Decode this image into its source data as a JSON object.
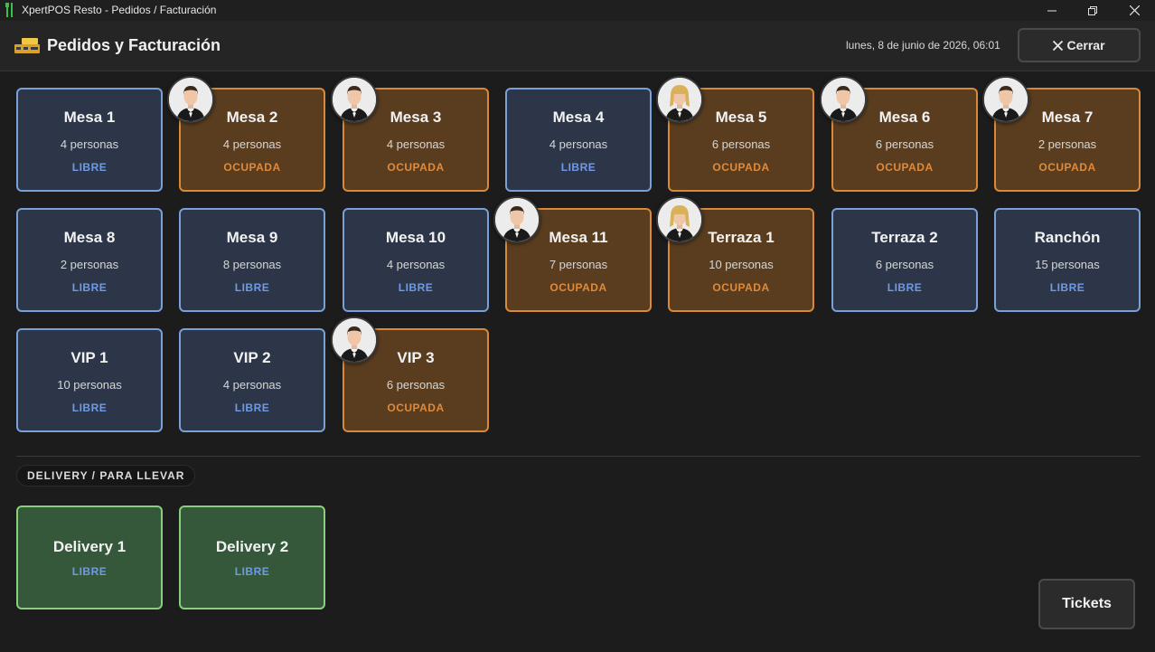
{
  "window": {
    "title": "XpertPOS Resto - Pedidos / Facturación",
    "controls": [
      "minimize-icon",
      "restore-icon",
      "close-icon"
    ]
  },
  "header": {
    "title": "Pedidos y Facturación",
    "icon": "cash-register-icon",
    "datetime": "lunes, 8 de junio de 2026, 06:01",
    "close_label": "Cerrar"
  },
  "colors": {
    "free_bg": "#2c3648",
    "free_border": "#7aa0d8",
    "free_text": "#6f9be6",
    "occupied_bg": "#5a3d1f",
    "occupied_border": "#d8893a",
    "occupied_text": "#e08a3a",
    "delivery_bg": "#35573a",
    "delivery_border": "#88d07c"
  },
  "tables": [
    {
      "name": "Mesa 1",
      "capacity": "4 personas",
      "status": "LIBRE",
      "waiter": null
    },
    {
      "name": "Mesa 2",
      "capacity": "4 personas",
      "status": "OCUPADA",
      "waiter": "male"
    },
    {
      "name": "Mesa 3",
      "capacity": "4 personas",
      "status": "OCUPADA",
      "waiter": "male"
    },
    {
      "name": "Mesa 4",
      "capacity": "4 personas",
      "status": "LIBRE",
      "waiter": null
    },
    {
      "name": "Mesa 5",
      "capacity": "6 personas",
      "status": "OCUPADA",
      "waiter": "female"
    },
    {
      "name": "Mesa 6",
      "capacity": "6 personas",
      "status": "OCUPADA",
      "waiter": "male"
    },
    {
      "name": "Mesa 7",
      "capacity": "2 personas",
      "status": "OCUPADA",
      "waiter": "male"
    },
    {
      "name": "Mesa 8",
      "capacity": "2 personas",
      "status": "LIBRE",
      "waiter": null
    },
    {
      "name": "Mesa 9",
      "capacity": "8 personas",
      "status": "LIBRE",
      "waiter": null
    },
    {
      "name": "Mesa 10",
      "capacity": "4 personas",
      "status": "LIBRE",
      "waiter": null
    },
    {
      "name": "Mesa 11",
      "capacity": "7 personas",
      "status": "OCUPADA",
      "waiter": "male"
    },
    {
      "name": "Terraza 1",
      "capacity": "10 personas",
      "status": "OCUPADA",
      "waiter": "female"
    },
    {
      "name": "Terraza 2",
      "capacity": "6 personas",
      "status": "LIBRE",
      "waiter": null
    },
    {
      "name": "Ranchón",
      "capacity": "15 personas",
      "status": "LIBRE",
      "waiter": null
    },
    {
      "name": "VIP 1",
      "capacity": "10 personas",
      "status": "LIBRE",
      "waiter": null
    },
    {
      "name": "VIP 2",
      "capacity": "4 personas",
      "status": "LIBRE",
      "waiter": null
    },
    {
      "name": "VIP 3",
      "capacity": "6 personas",
      "status": "OCUPADA",
      "waiter": "male"
    }
  ],
  "delivery": {
    "section_label": "DELIVERY / PARA LLEVAR",
    "items": [
      {
        "name": "Delivery 1",
        "status": "LIBRE"
      },
      {
        "name": "Delivery 2",
        "status": "LIBRE"
      }
    ]
  },
  "footer": {
    "tickets_label": "Tickets"
  }
}
